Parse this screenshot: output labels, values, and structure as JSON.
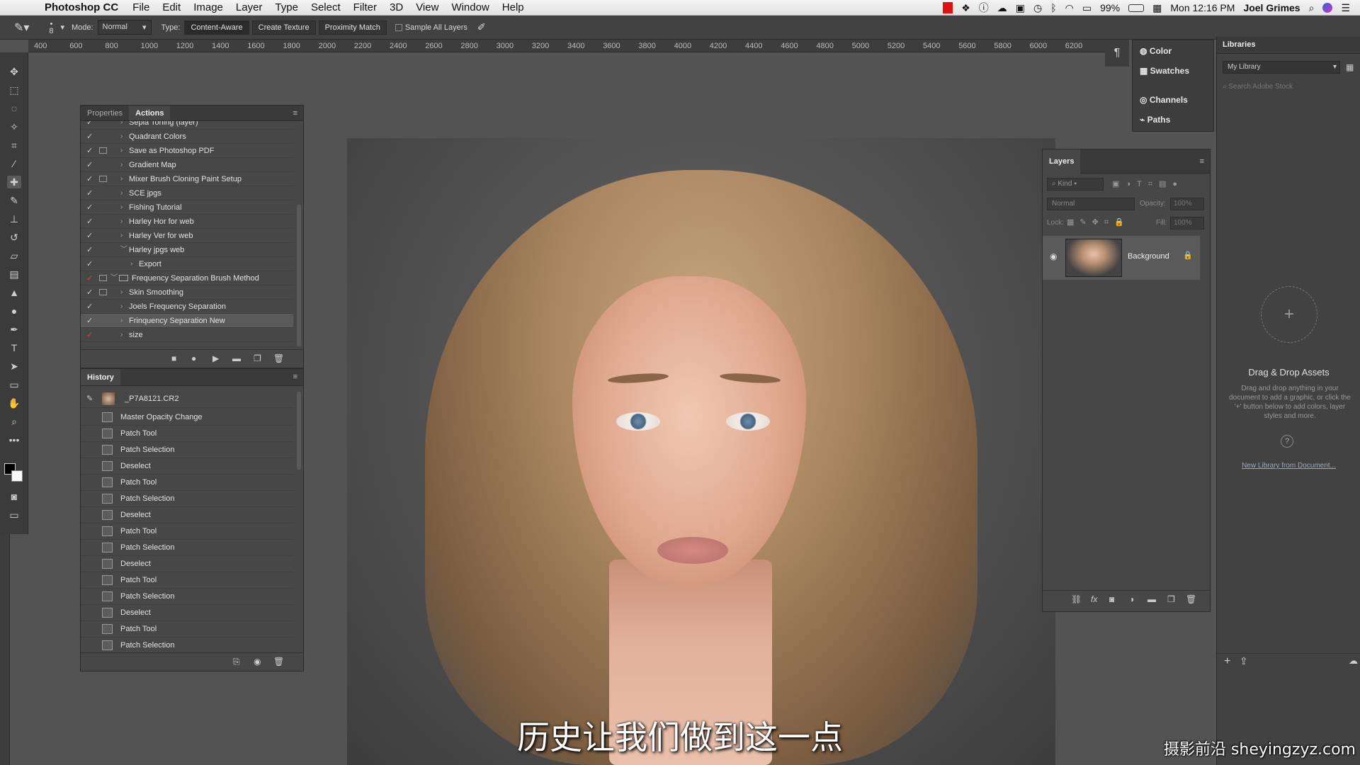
{
  "menubar": {
    "app_name": "Photoshop CC",
    "items": [
      "File",
      "Edit",
      "Image",
      "Layer",
      "Type",
      "Select",
      "Filter",
      "3D",
      "View",
      "Window",
      "Help"
    ],
    "battery": "99%",
    "clock": "Mon 12:16 PM",
    "user": "Joel Grimes"
  },
  "options": {
    "brush_size": "8",
    "mode_label": "Mode:",
    "mode_value": "Normal",
    "type_label": "Type:",
    "types": [
      "Content-Aware",
      "Create Texture",
      "Proximity Match"
    ],
    "sample_all_layers": "Sample All Layers"
  },
  "ruler": {
    "ticks": [
      "400",
      "600",
      "800",
      "1000",
      "1200",
      "1400",
      "1600",
      "1800",
      "2000",
      "2200",
      "2400",
      "2600",
      "2800",
      "3000",
      "3200",
      "3400",
      "3600",
      "3800",
      "4000",
      "4200",
      "4400",
      "4600",
      "4800",
      "5000",
      "5200",
      "5400",
      "5600",
      "5800",
      "6000",
      "6200"
    ]
  },
  "actions_panel": {
    "tabs": [
      "Properties",
      "Actions"
    ],
    "rows": [
      {
        "label": "Sepia Toning (layer)",
        "check": "✓",
        "dialog": false,
        "red": false,
        "level": 1,
        "expanded": false
      },
      {
        "label": "Quadrant Colors",
        "check": "✓",
        "dialog": false,
        "red": false,
        "level": 1,
        "expanded": false
      },
      {
        "label": "Save as Photoshop PDF",
        "check": "✓",
        "dialog": true,
        "red": false,
        "level": 1,
        "expanded": false
      },
      {
        "label": "Gradient Map",
        "check": "✓",
        "dialog": false,
        "red": false,
        "level": 1,
        "expanded": false
      },
      {
        "label": "Mixer Brush Cloning Paint Setup",
        "check": "✓",
        "dialog": true,
        "red": false,
        "level": 1,
        "expanded": false
      },
      {
        "label": "SCE jpgs",
        "check": "✓",
        "dialog": false,
        "red": false,
        "level": 1,
        "expanded": false
      },
      {
        "label": "Fishing Tutorial",
        "check": "✓",
        "dialog": false,
        "red": false,
        "level": 1,
        "expanded": false
      },
      {
        "label": "Harley Hor for web",
        "check": "✓",
        "dialog": false,
        "red": false,
        "level": 1,
        "expanded": false
      },
      {
        "label": "Harley Ver for web",
        "check": "✓",
        "dialog": false,
        "red": false,
        "level": 1,
        "expanded": false
      },
      {
        "label": "Harley jpgs web",
        "check": "✓",
        "dialog": false,
        "red": false,
        "level": 1,
        "expanded": true
      },
      {
        "label": "Export",
        "check": "✓",
        "dialog": false,
        "red": false,
        "level": 2,
        "expanded": false
      },
      {
        "label": "Frequency Separation Brush Method",
        "check": "✓",
        "dialog": true,
        "red": true,
        "level": 0,
        "expanded": true,
        "folder": true
      },
      {
        "label": "Skin Smoothing",
        "check": "✓",
        "dialog": true,
        "red": false,
        "level": 1,
        "expanded": false
      },
      {
        "label": "Joels Frequency Separation",
        "check": "✓",
        "dialog": false,
        "red": false,
        "level": 1,
        "expanded": false
      },
      {
        "label": "Frinquency Separation New",
        "check": "✓",
        "dialog": false,
        "red": false,
        "level": 1,
        "expanded": false,
        "selected": true
      },
      {
        "label": "size",
        "check": "✓",
        "dialog": false,
        "red": true,
        "level": 1,
        "expanded": false
      }
    ]
  },
  "history_panel": {
    "title": "History",
    "snapshot": "_P7A8121.CR2",
    "items": [
      "Master Opacity Change",
      "Patch Tool",
      "Patch Selection",
      "Deselect",
      "Patch Tool",
      "Patch Selection",
      "Deselect",
      "Patch Tool",
      "Patch Selection",
      "Deselect",
      "Patch Tool",
      "Patch Selection",
      "Deselect",
      "Patch Tool",
      "Patch Selection"
    ]
  },
  "right_dock": {
    "items": [
      "Color",
      "Swatches",
      "Channels",
      "Paths"
    ]
  },
  "layers_panel": {
    "title": "Layers",
    "filter_kind": "Kind",
    "blend_mode": "Normal",
    "opacity_label": "Opacity:",
    "opacity_value": "100%",
    "lock_label": "Lock:",
    "fill_label": "Fill:",
    "fill_value": "100%",
    "layer_name": "Background"
  },
  "libraries": {
    "title": "Libraries",
    "library": "My Library",
    "search_placeholder": "Search Adobe Stock",
    "dnd_title": "Drag & Drop Assets",
    "dnd_text": "Drag and drop anything in your document to add a graphic, or click the '+' button below to add colors, layer styles and more.",
    "new_library_link": "New Library from Document..."
  },
  "subtitle": "历史让我们做到这一点",
  "watermark": "摄影前沿 sheyingzyz.com"
}
